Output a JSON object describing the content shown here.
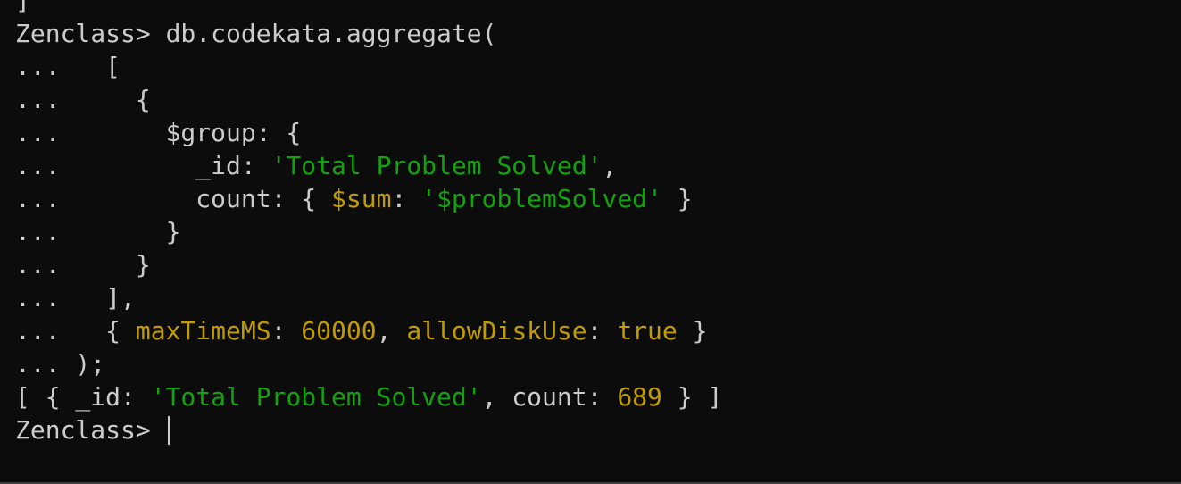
{
  "terminal": {
    "lines": [
      [
        {
          "t": "]",
          "c": "default"
        }
      ],
      [
        {
          "t": "Zenclass> db.codekata.aggregate(",
          "c": "default"
        }
      ],
      [
        {
          "t": "...   [",
          "c": "default"
        }
      ],
      [
        {
          "t": "...     {",
          "c": "default"
        }
      ],
      [
        {
          "t": "...       $group: {",
          "c": "default"
        }
      ],
      [
        {
          "t": "...         _id: ",
          "c": "default"
        },
        {
          "t": "'Total Problem Solved'",
          "c": "green"
        },
        {
          "t": ",",
          "c": "default"
        }
      ],
      [
        {
          "t": "...         count: { ",
          "c": "default"
        },
        {
          "t": "$sum",
          "c": "yellow"
        },
        {
          "t": ": ",
          "c": "default"
        },
        {
          "t": "'$problemSolved'",
          "c": "green"
        },
        {
          "t": " }",
          "c": "default"
        }
      ],
      [
        {
          "t": "...       }",
          "c": "default"
        }
      ],
      [
        {
          "t": "...     }",
          "c": "default"
        }
      ],
      [
        {
          "t": "...   ],",
          "c": "default"
        }
      ],
      [
        {
          "t": "...   { ",
          "c": "default"
        },
        {
          "t": "maxTimeMS",
          "c": "yellow"
        },
        {
          "t": ": ",
          "c": "default"
        },
        {
          "t": "60000",
          "c": "yellow"
        },
        {
          "t": ", ",
          "c": "default"
        },
        {
          "t": "allowDiskUse",
          "c": "yellow"
        },
        {
          "t": ": ",
          "c": "default"
        },
        {
          "t": "true",
          "c": "yellow"
        },
        {
          "t": " }",
          "c": "default"
        }
      ],
      [
        {
          "t": "... );",
          "c": "default"
        }
      ],
      [
        {
          "t": "[ { _id: ",
          "c": "default"
        },
        {
          "t": "'Total Problem Solved'",
          "c": "green"
        },
        {
          "t": ", count: ",
          "c": "default"
        },
        {
          "t": "689",
          "c": "yellow"
        },
        {
          "t": " } ]",
          "c": "default"
        }
      ],
      [
        {
          "t": "Zenclass> ",
          "c": "default"
        }
      ]
    ],
    "prompt": "Zenclass>"
  },
  "colors": {
    "background": "#0c0c0c",
    "default_text": "#cccccc",
    "string": "#13a10e",
    "keyword_number": "#c19c00"
  }
}
